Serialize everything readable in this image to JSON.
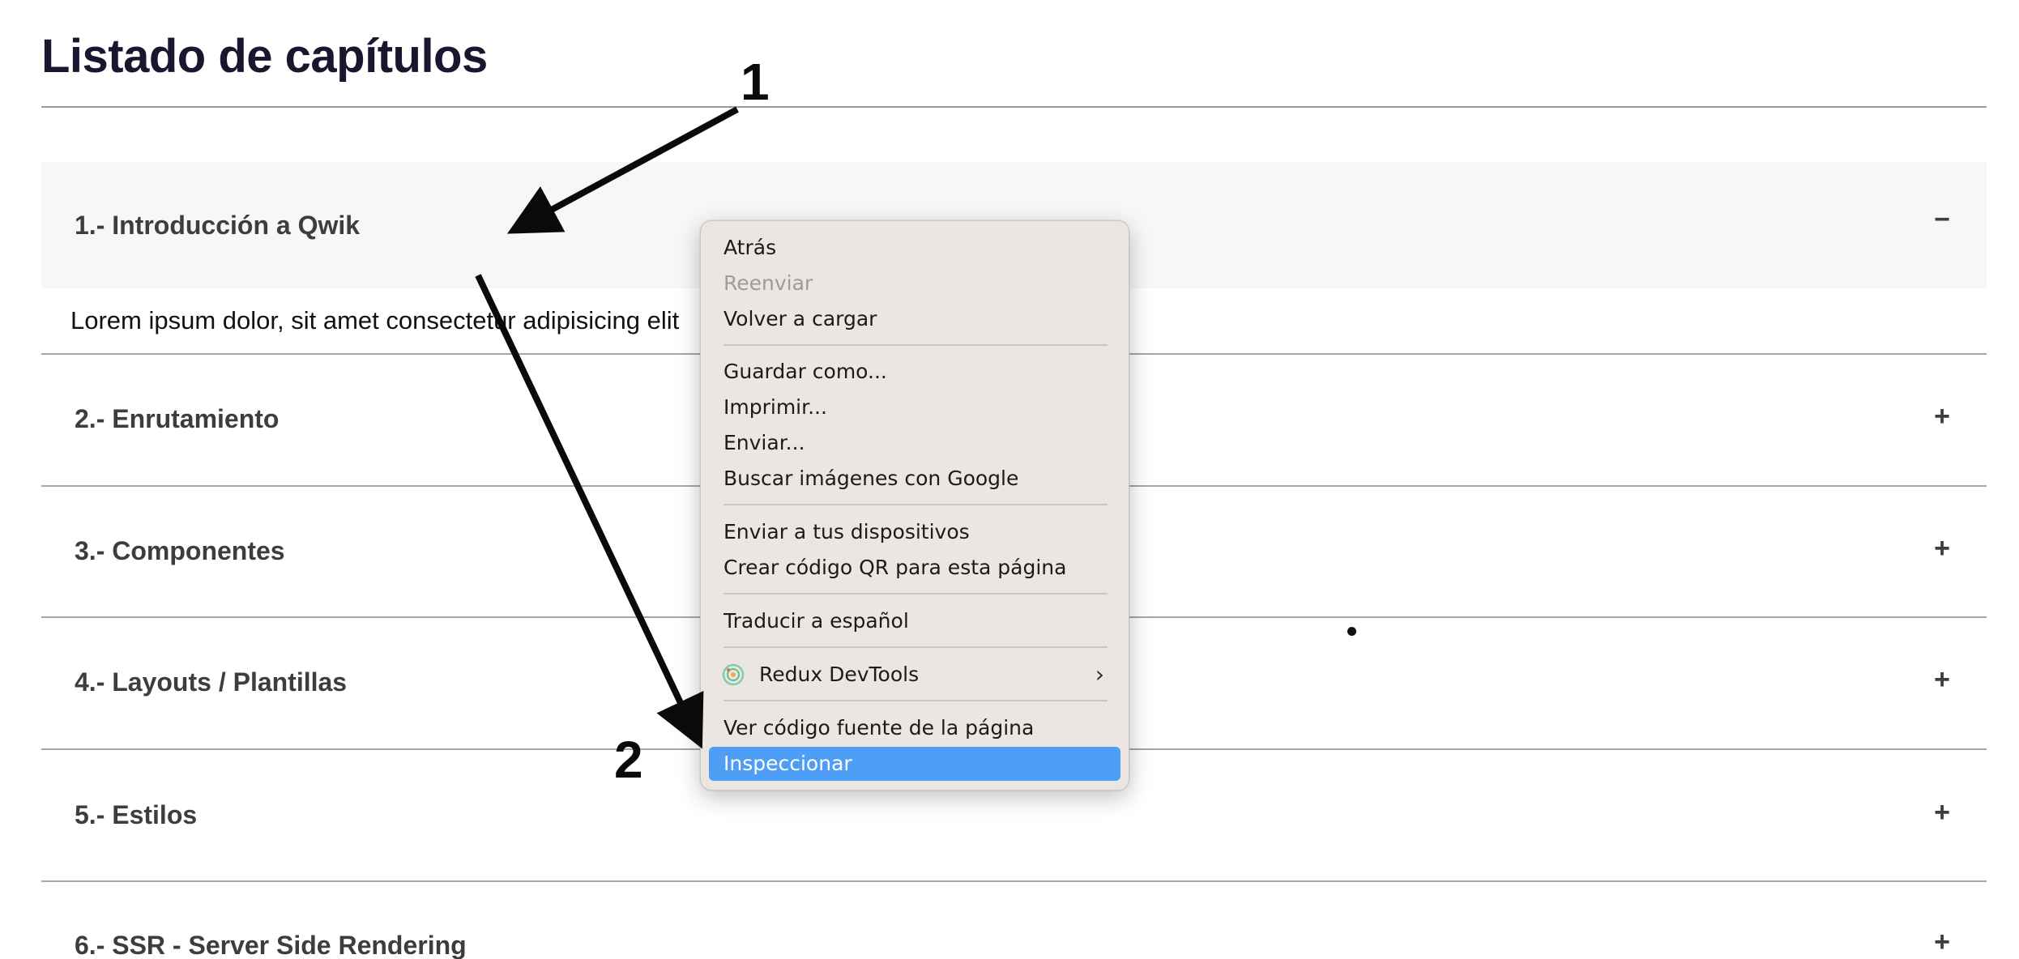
{
  "page": {
    "title": "Listado de capítulos"
  },
  "chapters": [
    {
      "title": "1.- Introducción a Qwik",
      "toggle": "−",
      "expanded": true,
      "body": "Lorem ipsum dolor, sit amet consectetur adipisicing elit"
    },
    {
      "title": "2.- Enrutamiento",
      "toggle": "+",
      "expanded": false
    },
    {
      "title": "3.- Componentes",
      "toggle": "+",
      "expanded": false
    },
    {
      "title": "4.- Layouts / Plantillas",
      "toggle": "+",
      "expanded": false
    },
    {
      "title": "5.- Estilos",
      "toggle": "+",
      "expanded": false
    },
    {
      "title": "6.- SSR - Server Side Rendering",
      "toggle": "+",
      "expanded": false
    }
  ],
  "context_menu": {
    "items": {
      "back": "Atrás",
      "forward": "Reenviar",
      "reload": "Volver a cargar",
      "save_as": "Guardar como...",
      "print": "Imprimir...",
      "send": "Enviar...",
      "search_images": "Buscar imágenes con Google",
      "send_devices": "Enviar a tus dispositivos",
      "qr_code": "Crear código QR para esta página",
      "translate": "Traducir a español",
      "redux_devtools": "Redux DevTools",
      "view_source": "Ver código fuente de la página",
      "inspect": "Inspeccionar"
    },
    "disabled": [
      "forward"
    ],
    "selected": "inspect",
    "icons": {
      "redux_devtools": "redux-devtools-icon",
      "submenu": "chevron-right-icon"
    },
    "colors": {
      "background": "#ebe6e3",
      "highlight": "#4f9ef5"
    }
  },
  "annotations": {
    "label_1": "1",
    "label_2": "2"
  },
  "colors": {
    "title": "#18172f",
    "chapter_text": "#3d3d3d",
    "expanded_header_bg": "#f7f7f7"
  }
}
